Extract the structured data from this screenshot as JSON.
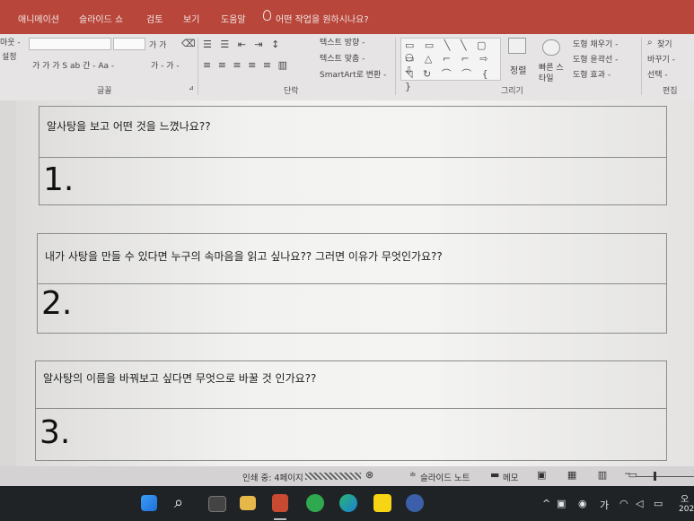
{
  "ribbon_tabs": [
    "애니메이션",
    "슬라이드 쇼",
    "검토",
    "보기",
    "도움말"
  ],
  "tell_me": "어떤 작업을 원하시나요?",
  "ribbon": {
    "left_partial_1": "마웃 -",
    "left_partial_2": "설정",
    "font_btns": "가 가 가 S ab 간 - Aa -",
    "font_color": "가 - 가 -",
    "grow_shrink": "가 가",
    "group_font": "글꼴",
    "group_paragraph": "단락",
    "text_direction": "텍스트 방향 -",
    "text_align": "텍스트 맞춤 -",
    "smartart": "SmartArt로 변환 -",
    "arrange": "정렬",
    "quick_styles": "빠른 스타일",
    "shape_fill": "도형 채우기 -",
    "shape_outline": "도형 윤곽선 -",
    "shape_effects": "도형 효과 -",
    "group_drawing": "그리기",
    "find": "찾기",
    "replace": "바꾸기 -",
    "select": "선택 -",
    "group_editing": "편집"
  },
  "slide": {
    "questions": [
      {
        "text": "알사탕을 보고 어떤 것을 느꼈나요??",
        "number": "1."
      },
      {
        "text": "내가 사탕을 만들 수 있다면 누구의 속마음을 읽고 싶나요?? 그러면 이유가 무엇인가요??",
        "number": "2."
      },
      {
        "text": "알사탕의 이름을 바꿔보고 싶다면 무엇으로 바꿀 것 인가요??",
        "number": "3."
      }
    ]
  },
  "status": {
    "printing": "인쇄 중: 4페이지",
    "notes": "슬라이드 노트",
    "memo": "메모"
  },
  "tray": {
    "ime": "가",
    "clock_partial_1": "오",
    "clock_partial_2": "202"
  },
  "colors": {
    "ribbon_tab_bg": "#b8463a",
    "ribbon_bg": "#e6e4e4",
    "taskbar_bg": "#1f2326"
  }
}
